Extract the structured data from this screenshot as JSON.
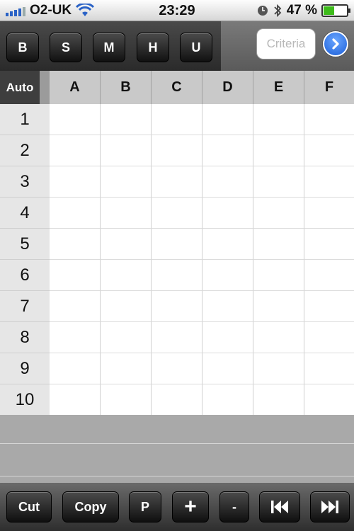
{
  "status_bar": {
    "carrier": "O2-UK",
    "time": "23:29",
    "battery": "47 %",
    "battery_level": 0.47
  },
  "format_toolbar": {
    "buttons": [
      "B",
      "S",
      "M",
      "H",
      "U"
    ],
    "criteria_placeholder": "Criteria"
  },
  "grid": {
    "corner_label": "Auto",
    "columns": [
      "A",
      "B",
      "C",
      "D",
      "E",
      "F"
    ],
    "rows": [
      "1",
      "2",
      "3",
      "4",
      "5",
      "6",
      "7",
      "8",
      "9",
      "10"
    ]
  },
  "bottom_toolbar": {
    "cut": "Cut",
    "copy": "Copy",
    "paste": "P",
    "plus": "+",
    "minus": "-"
  },
  "colors": {
    "signal": "#2a62c6",
    "battery_fill": "#3dbb1a",
    "go_button": "#1c5fd8"
  }
}
